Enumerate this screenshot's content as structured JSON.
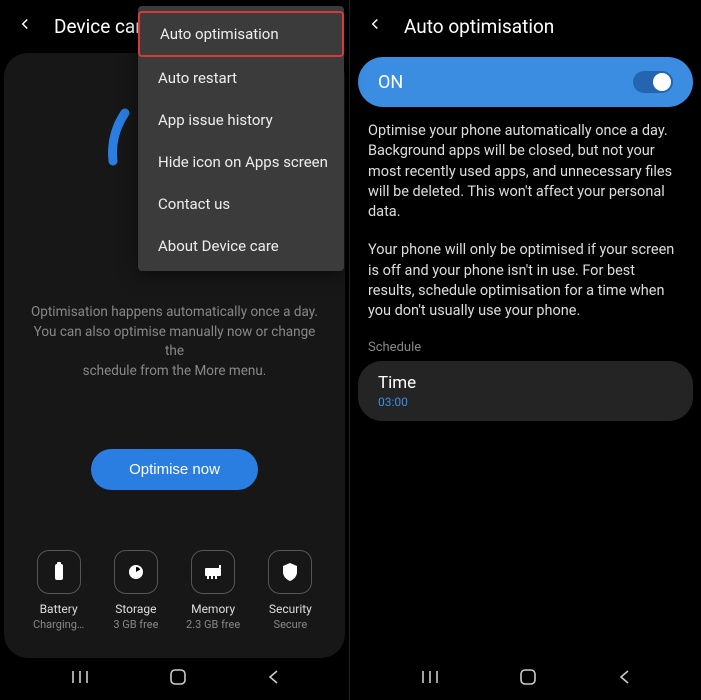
{
  "left": {
    "header_title": "Device care",
    "menu": {
      "items": [
        "Auto optimisation",
        "Auto restart",
        "App issue history",
        "Hide icon on Apps screen",
        "Contact us",
        "About Device care"
      ]
    },
    "opt_text_l1": "Optimisation happens automatically once a day.",
    "opt_text_l2": "You can also optimise manually now or change the",
    "opt_text_l3": "schedule from the More menu.",
    "optimise_btn": "Optimise now",
    "stats": [
      {
        "label": "Battery",
        "value": "Charging…"
      },
      {
        "label": "Storage",
        "value": "3 GB free"
      },
      {
        "label": "Memory",
        "value": "2.3 GB free"
      },
      {
        "label": "Security",
        "value": "Secure"
      }
    ]
  },
  "right": {
    "header_title": "Auto optimisation",
    "toggle_label": "ON",
    "desc1": "Optimise your phone automatically once a day. Background apps will be closed, but not your most recently used apps, and unnecessary files will be deleted. This won't affect your personal data.",
    "desc2": "Your phone will only be optimised if your screen is off and your phone isn't in use. For best results, schedule optimisation for a time when you don't usually use your phone.",
    "schedule_label": "Schedule",
    "time_label": "Time",
    "time_value": "03:00"
  }
}
